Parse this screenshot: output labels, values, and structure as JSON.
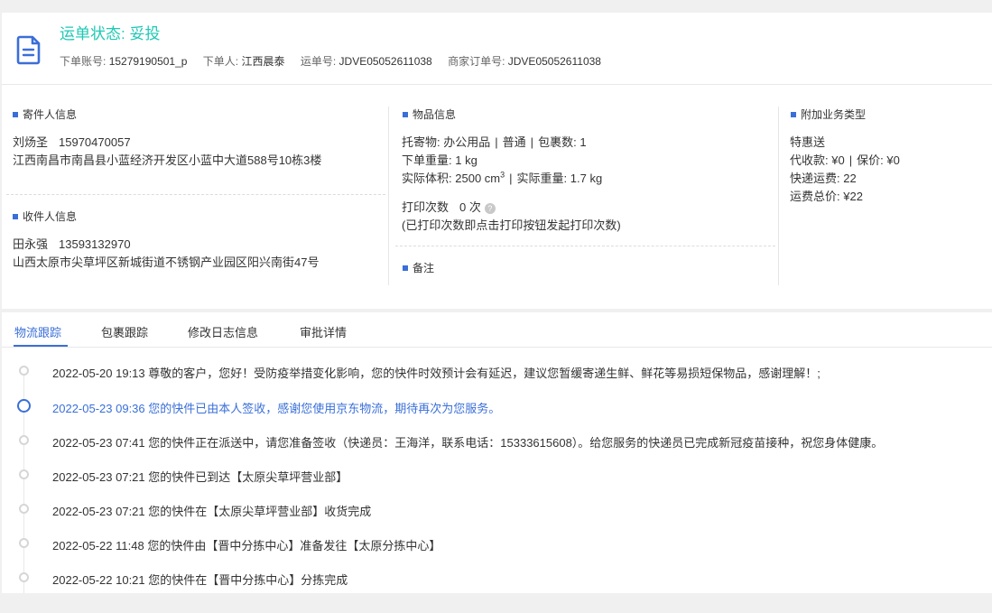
{
  "header": {
    "status_label": "运单状态: ",
    "status_value": "妥投",
    "account_label": "下单账号:",
    "account_value": "15279190501_p",
    "orderer_label": "下单人:",
    "orderer_value": "江西晨泰",
    "waybill_label": "运单号:",
    "waybill_value": "JDVE05052611038",
    "merchant_order_label": "商家订单号:",
    "merchant_order_value": "JDVE05052611038",
    "icon": "document-icon"
  },
  "sender": {
    "title": "寄件人信息",
    "name": "刘炀圣",
    "phone": "15970470057",
    "address": "江西南昌市南昌县小蓝经济开发区小蓝中大道588号10栋3楼"
  },
  "receiver": {
    "title": "收件人信息",
    "name": "田永强",
    "phone": "13593132970",
    "address": "山西太原市尖草坪区新城街道不锈钢产业园区阳兴南街47号"
  },
  "goods": {
    "title": "物品信息",
    "consignment_label": "托寄物:",
    "consignment_value": "办公用品",
    "service_value": "普通",
    "packages_label": "包裹数:",
    "packages_value": "1",
    "order_weight_label": "下单重量:",
    "order_weight_value": "1 kg",
    "volume_label": "实际体积:",
    "volume_value": "2500 cm",
    "volume_exp": "3",
    "actual_weight_label": "实际重量:",
    "actual_weight_value": "1.7 kg",
    "print_label": "打印次数",
    "print_value": "0 次",
    "help_glyph": "?",
    "print_note": "(已打印次数即点击打印按钮发起打印次数)",
    "remark_title": "备注"
  },
  "extra": {
    "title": "附加业务类型",
    "product": "特惠送",
    "cod_label": "代收款:",
    "cod_value": "¥0",
    "insure_label": "保价:",
    "insure_value": "¥0",
    "express_fee_label": "快递运费:",
    "express_fee_value": "22",
    "total_label": "运费总价:",
    "total_value": "¥22"
  },
  "tabs": [
    {
      "label": "物流跟踪",
      "active": true
    },
    {
      "label": "包裹跟踪",
      "active": false
    },
    {
      "label": "修改日志信息",
      "active": false
    },
    {
      "label": "审批详情",
      "active": false
    }
  ],
  "events": [
    {
      "time": "2022-05-20 19:13",
      "text": "尊敬的客户，您好！受防疫举措变化影响，您的快件时效预计会有延迟，建议您暂缓寄递生鲜、鲜花等易损短保物品，感谢理解！;",
      "current": false
    },
    {
      "time": "2022-05-23 09:36",
      "text": "您的快件已由本人签收，感谢您使用京东物流，期待再次为您服务。",
      "current": true
    },
    {
      "time": "2022-05-23 07:41",
      "text": "您的快件正在派送中，请您准备签收（快递员：王海洋，联系电话：15333615608）。给您服务的快递员已完成新冠疫苗接种，祝您身体健康。",
      "current": false
    },
    {
      "time": "2022-05-23 07:21",
      "text": "您的快件已到达【太原尖草坪营业部】",
      "current": false
    },
    {
      "time": "2022-05-23 07:21",
      "text": "您的快件在【太原尖草坪营业部】收货完成",
      "current": false
    },
    {
      "time": "2022-05-22 11:48",
      "text": "您的快件由【晋中分拣中心】准备发往【太原分拣中心】",
      "current": false
    },
    {
      "time": "2022-05-22 10:21",
      "text": "您的快件在【晋中分拣中心】分拣完成",
      "current": false
    }
  ],
  "colors": {
    "status": "#1ec8b4",
    "accent": "#3a6fd8",
    "text": "#333333",
    "muted": "#666666"
  }
}
